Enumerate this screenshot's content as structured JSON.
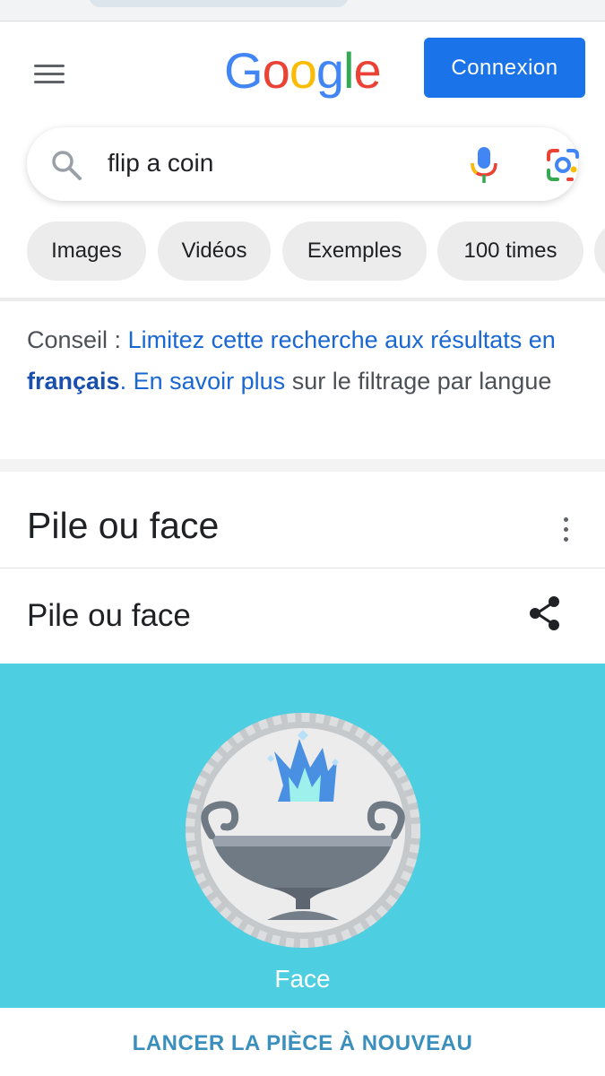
{
  "header": {
    "logo": {
      "letters": [
        "G",
        "o",
        "o",
        "g",
        "l",
        "e"
      ],
      "colors": [
        "#4285F4",
        "#EA4335",
        "#FBBC05",
        "#4285F4",
        "#34A853",
        "#EA4335"
      ]
    },
    "signin_label": "Connexion"
  },
  "search": {
    "query": "flip a coin"
  },
  "chips": [
    {
      "label": "Images"
    },
    {
      "label": "Vidéos"
    },
    {
      "label": "Exemples"
    },
    {
      "label": "100 times"
    }
  ],
  "tip": {
    "prefix": "Conseil : ",
    "link1_a": "Limitez cette recherche aux résultats en ",
    "link1_b": "français",
    "link1_c": ".",
    "link2": "En savoir plus",
    "suffix": " sur le filtrage par langue"
  },
  "card": {
    "title": "Pile ou face",
    "subtitle": "Pile ou face",
    "coin_result": "Face",
    "relaunch_label": "LANCER LA PIÈCE À NOUVEAU"
  },
  "colors": {
    "accent": "#1a73e8",
    "coin_bg": "#4dcfe1",
    "link": "#1967d2",
    "relaunch": "#3a8fbd"
  }
}
